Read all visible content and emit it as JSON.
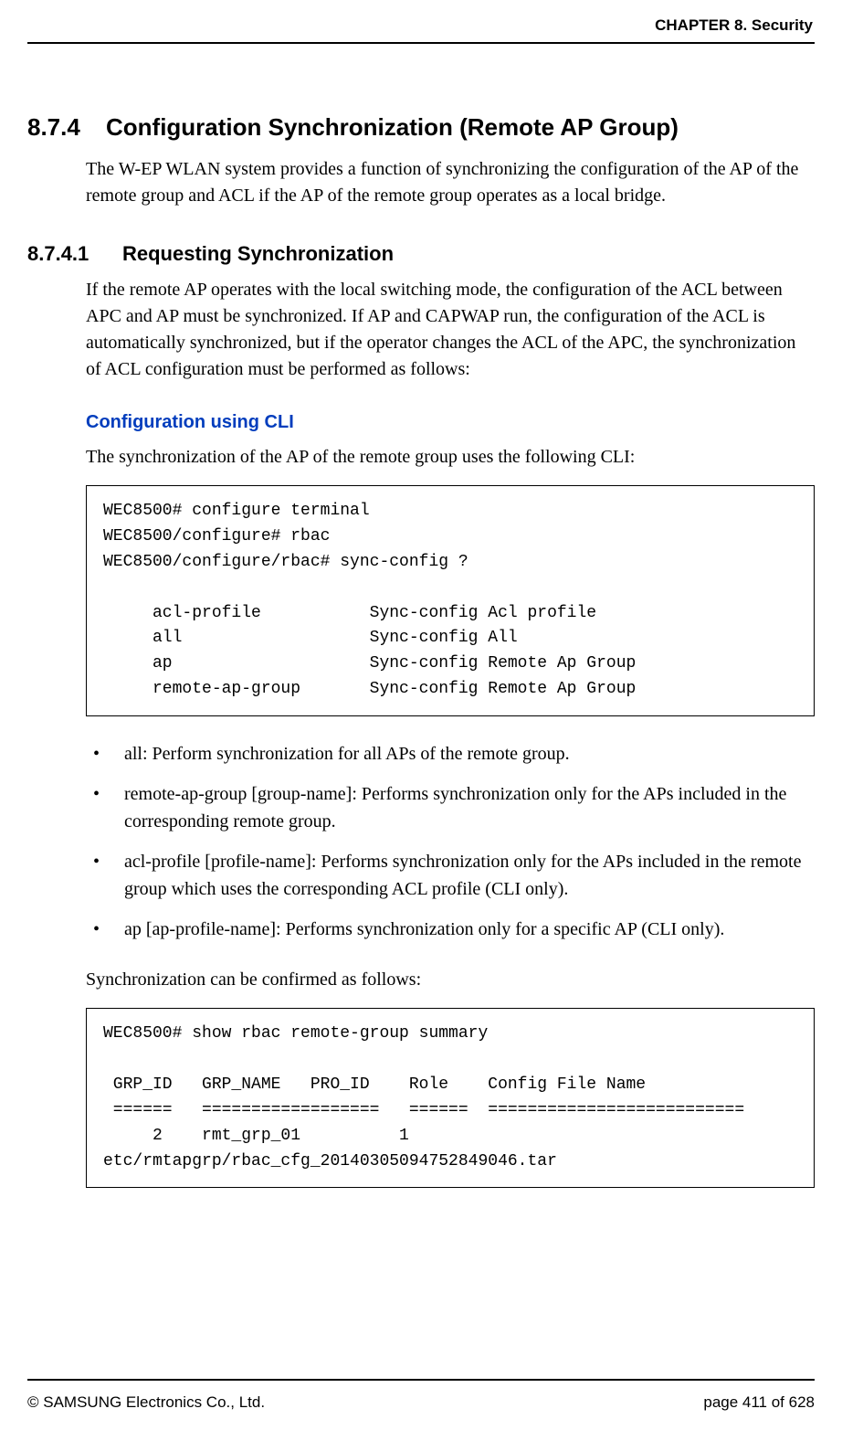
{
  "header": {
    "chapter": "CHAPTER 8. Security"
  },
  "sections": {
    "s874": {
      "number": "8.7.4",
      "title": "Configuration Synchronization (Remote AP Group)",
      "intro": "The W-EP WLAN system provides a function of synchronizing the configuration of the AP of the remote group and ACL if the AP of the remote group operates as a local bridge."
    },
    "s8741": {
      "number": "8.7.4.1",
      "title": "Requesting Synchronization",
      "intro": "If the remote AP operates with the local switching mode, the configuration of the ACL between APC and AP must be synchronized. If AP and CAPWAP run, the configuration of the ACL is automatically synchronized, but if the operator changes the ACL of the APC, the synchronization of ACL configuration must be performed as follows:",
      "cli_heading": "Configuration using CLI",
      "cli_intro": "The synchronization of the AP of the remote group uses the following CLI:",
      "code1": "WEC8500# configure terminal \nWEC8500/configure# rbac \nWEC8500/configure/rbac# sync-config ?\n\n     acl-profile           Sync-config Acl profile\n     all                   Sync-config All\n     ap                    Sync-config Remote Ap Group\n     remote-ap-group       Sync-config Remote Ap Group",
      "bullets": [
        "all: Perform synchronization for all APs of the remote group.",
        "remote-ap-group [group-name]: Performs synchronization only for the APs included in the corresponding remote group.",
        "acl-profile [profile-name]: Performs synchronization only for the APs included in the remote group which uses the corresponding ACL profile (CLI only).",
        "ap [ap-profile-name]: Performs synchronization only for a specific AP (CLI only)."
      ],
      "confirm_text": "Synchronization can be confirmed as follows:",
      "code2": "WEC8500# show rbac remote-group summary\n\n GRP_ID   GRP_NAME   PRO_ID    Role    Config File Name \n ======   ==================   ======  ==========================\n     2    rmt_grp_01          1 \netc/rmtapgrp/rbac_cfg_20140305094752849046.tar"
    }
  },
  "footer": {
    "copyright": "© SAMSUNG Electronics Co., Ltd.",
    "page": "page 411 of 628"
  },
  "glyphs": {
    "bullet": "•"
  }
}
